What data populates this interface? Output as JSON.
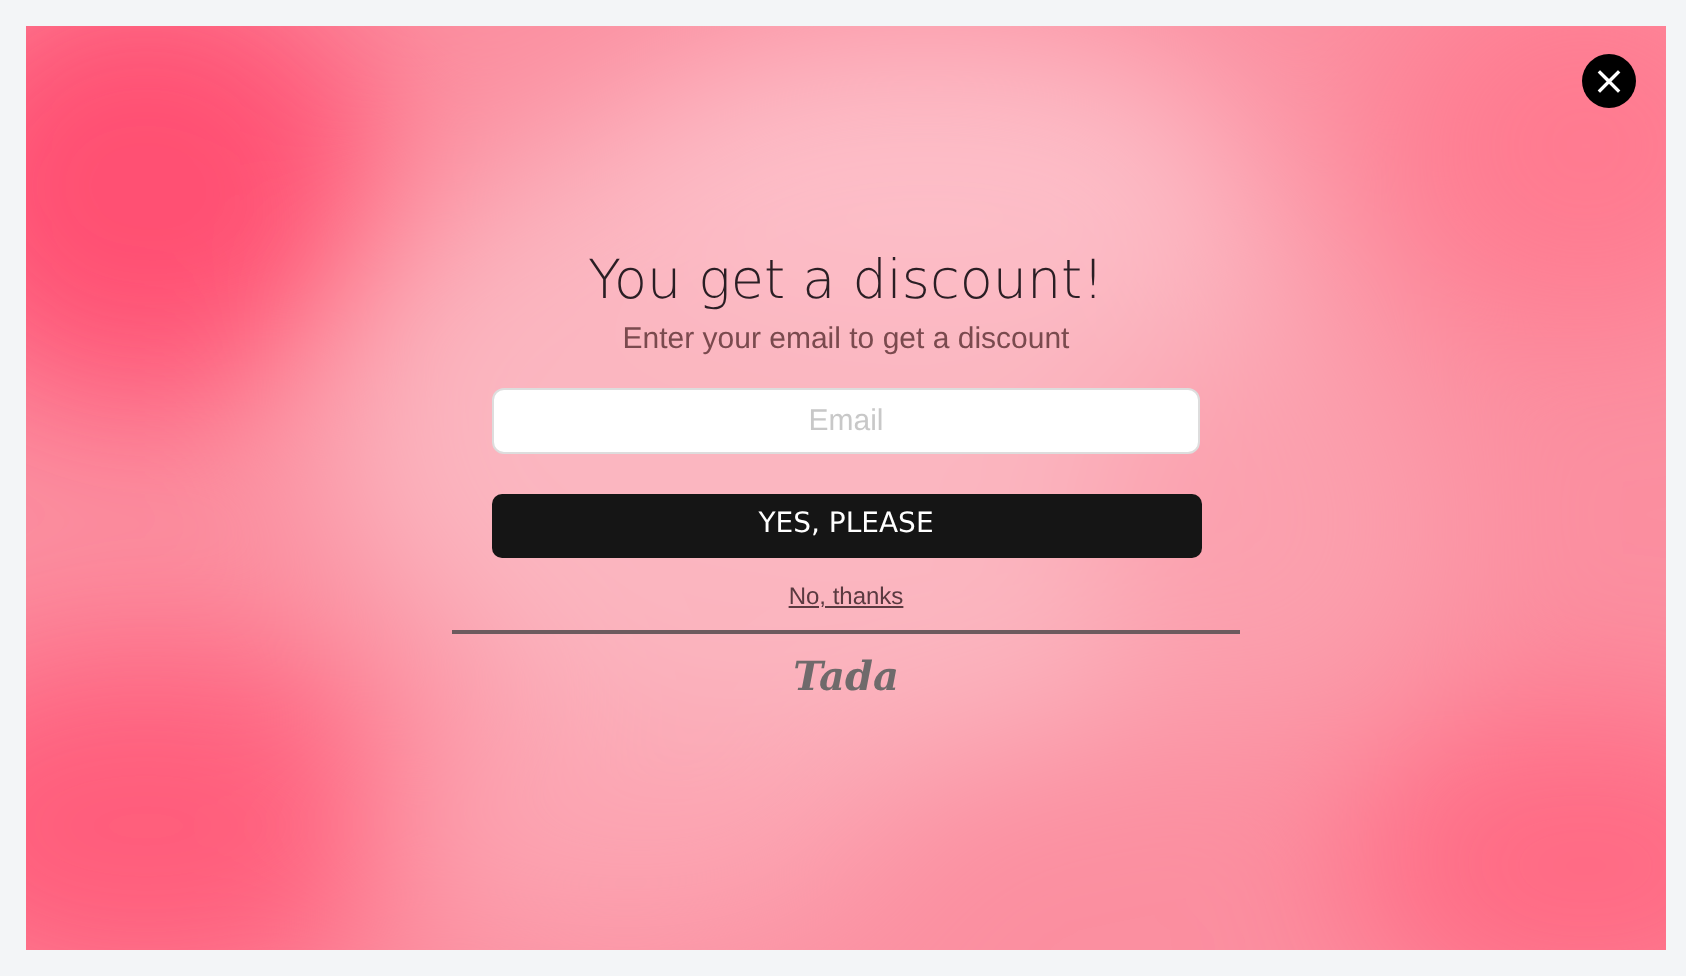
{
  "popup": {
    "close_button": "×",
    "title": "You get a discount!",
    "subtitle": "Enter your email to get a discount",
    "email_field": {
      "placeholder": "Email"
    },
    "submit_button": "YES, PLEASE",
    "decline_link": "No, thanks",
    "brand_logo": "Tada"
  }
}
